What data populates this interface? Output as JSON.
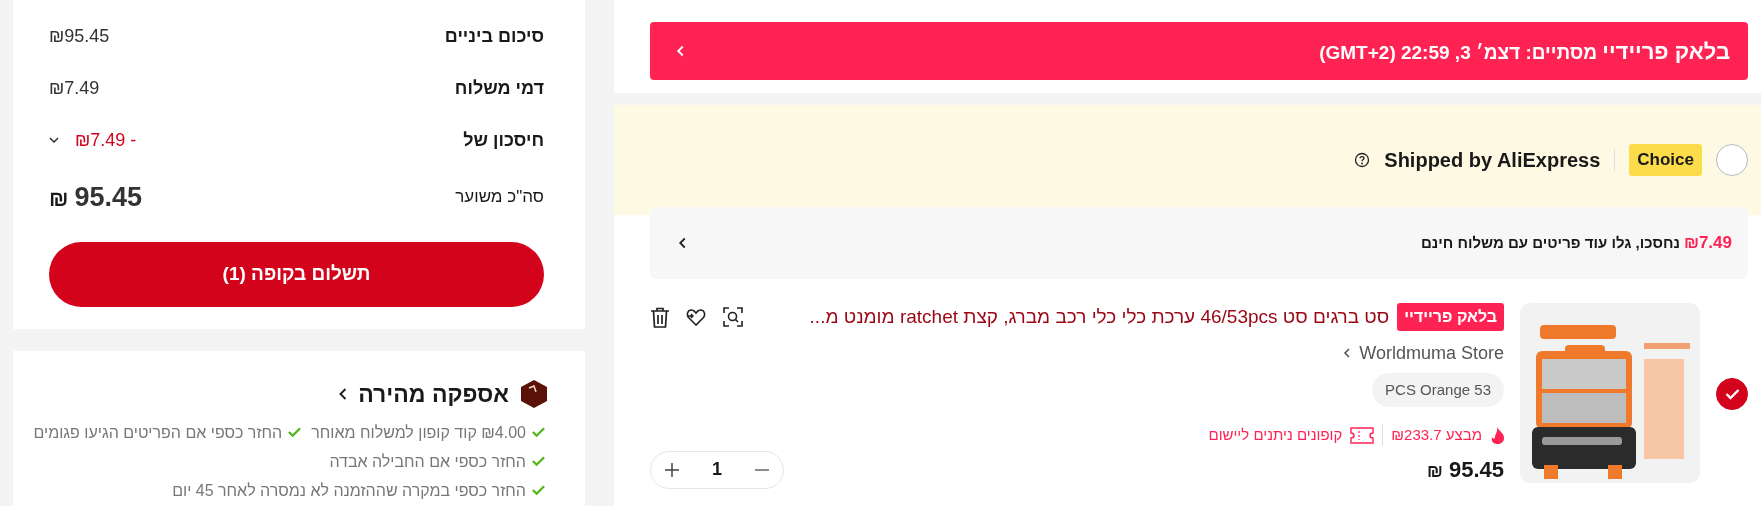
{
  "cart": {
    "banner": {
      "text": "**בלאק פריידיי** מסתיים: דצמ׳ 3, 22:59 (GMT+2)"
    },
    "store_group": {
      "selected": false,
      "badge": "Choice",
      "title": "Shipped by AliExpress"
    },
    "free_shipping": {
      "amount": "₪7.49",
      "text": "נחסכו, גלו עוד פריטים עם משלוח חינם"
    },
    "items": [
      {
        "selected": true,
        "badge": "בלאק פריידיי",
        "title": "סט ברגים סט 46/53pcs ערכת כלי כלי רכב מברג, קצת ratchet מומנט מ...",
        "store": "Worldmuma Store",
        "variant": "PCS Orange 53",
        "sale": "מבצע ₪233.7",
        "coupons": "קופונים ניתנים ליישום",
        "price": {
          "currency": "₪",
          "amount": "95.45"
        },
        "quantity": "1"
      }
    ]
  },
  "summary": {
    "rows": [
      {
        "label": "סיכום ביניים",
        "value": "₪95.45",
        "kind": "plain"
      },
      {
        "label": "דמי משלוח",
        "value": "₪7.49",
        "kind": "plain"
      },
      {
        "label": "חיסכון של",
        "value": "- ₪7.49",
        "kind": "discount"
      }
    ],
    "total": {
      "label": "סה\"כ משוער",
      "currency": "₪",
      "amount": "95.45"
    },
    "checkout_button": "תשלום בקופה (1)"
  },
  "delivery": {
    "title": "אספקה מהירה",
    "benefits": [
      "₪4.00 קוד קופון למשלוח מאוחר",
      "החזר כספי אם הפריטים הגיעו פגומים",
      "החזר כספי אם החבילה אבדה",
      "החזר כספי במקרה שההזמנה לא נמסרה לאחר 45 יום"
    ]
  }
}
